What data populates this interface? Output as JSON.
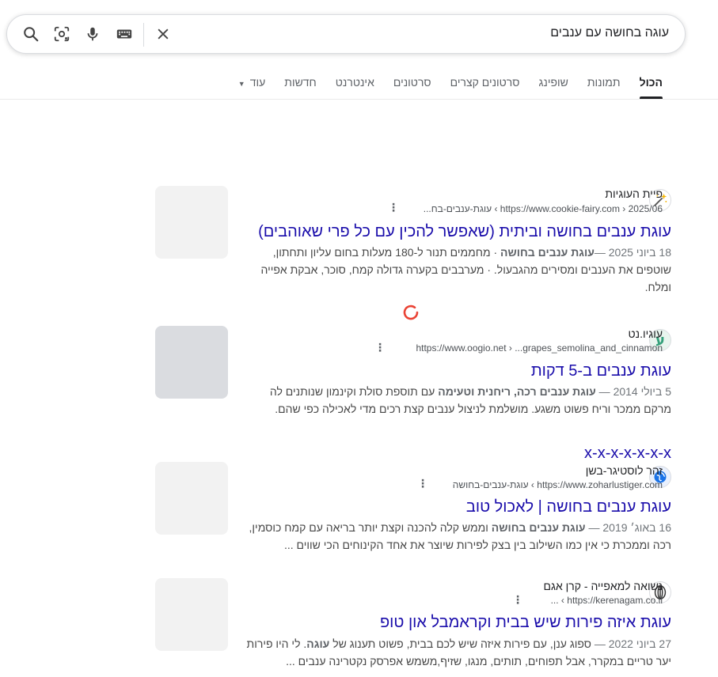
{
  "search": {
    "query": "עוגה בחושה עם ענבים",
    "icons": [
      "search-icon",
      "camera-lens-icon",
      "mic-icon",
      "keyboard-icon",
      "clear-icon"
    ]
  },
  "tabs": [
    {
      "label": "הכול",
      "active": true
    },
    {
      "label": "תמונות"
    },
    {
      "label": "שופינג"
    },
    {
      "label": "סרטונים קצרים"
    },
    {
      "label": "סרטונים"
    },
    {
      "label": "אינטרנט"
    },
    {
      "label": "חדשות"
    },
    {
      "label": "עוד"
    }
  ],
  "results": [
    {
      "site": "פיית העוגיות",
      "url": "https://www.cookie-fairy.com › 2025/06 › עוגת-ענבים-בח...",
      "title": "עוגת ענבים בחושה וביתית (שאפשר להכין עם כל פרי שאוהבים)",
      "date": "18 ביוני 2025 —",
      "snippet_parts": [
        {
          "t": " מחממים תנור ל-180 מעלות בחום עליון ותחתון, שוטפים את הענבים ומסירים מהגבעול. · מערבבים בקערה גדולה קמח, סוכר, אבקת אפייה ומלח.",
          "bold": false
        }
      ],
      "snippet_bold": "עוגת ענבים בחושה",
      "snippet_pre": "",
      "snippet_post": " · מחממים תנור ל-180 מעלות בחום עליון ותחתון, שוטפים את הענבים ומסירים מהגבעול. · מערבבים בקערה גדולה קמח, סוכר, אבקת אפייה ומלח."
    },
    {
      "site": "עוגיו.נט",
      "url": "https://www.oogio.net › ...grapes_semolina_and_cinnamon",
      "title": "עוגת ענבים ב-5 דקות",
      "date": "5 ביולי 2014 —",
      "snippet_pre": " ",
      "snippet_bold": "עוגת ענבים רכה, ריחנית וטעימה",
      "snippet_post": " עם תוספת סולת וקינמון שנותנים לה מרקם ממכר וריח פשוט משגע. מושלמת לניצול ענבים קצת רכים מדי לאכילה כפי שהם."
    },
    {
      "site": "זהר לוסטיגר-בשן",
      "url": "https://www.zoharlustiger.com › עוגת-ענבים-בחושה",
      "title": "עוגת ענבים בחושה | לאכול טוב",
      "date": "16 באוג׳ 2019 —",
      "snippet_pre": " ",
      "snippet_bold": "עוגת ענבים בחושה",
      "snippet_post": " וממש קלה להכנה וקצת יותר בריאה עם קמח כוסמין, רכה וממכרת כי אין כמו השילוב בין בצק לפירות שיוצר את אחד הקינוחים הכי שווים ..."
    },
    {
      "site": "נשואה למאפייה - קרן אגם",
      "url": "https://kerenagam.co.il › ...",
      "title": "עוגת איזה פירות שיש בבית וקראמבל און טופ",
      "date": "27 ביוני 2022 —",
      "snippet_pre": " ספוג ענן, עם פירות איזה שיש לכם בבית, פשוט תענוג של ",
      "snippet_bold": "עוגה",
      "snippet_post": ". לי היו פירות יער טריים במקרר, אבל תפוחים, תותים, מנגו, שזיף,משמש אפרסק נקטרינה ענבים ..."
    }
  ],
  "xtitle": "x-x-x-x-x-x-x"
}
